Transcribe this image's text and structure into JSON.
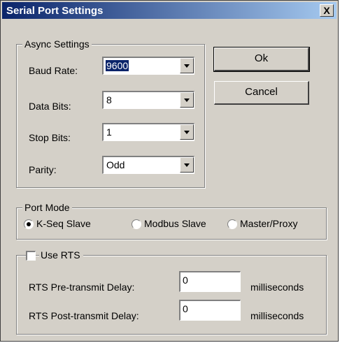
{
  "window": {
    "title": "Serial Port Settings",
    "close_label": "X"
  },
  "async": {
    "legend": "Async Settings",
    "baud_label": "Baud Rate:",
    "baud_value": "9600",
    "databits_label": "Data Bits:",
    "databits_value": "8",
    "stopbits_label": "Stop Bits:",
    "stopbits_value": "1",
    "parity_label": "Parity:",
    "parity_value": "Odd"
  },
  "buttons": {
    "ok": "Ok",
    "cancel": "Cancel"
  },
  "port_mode": {
    "legend": "Port Mode",
    "options": [
      "K-Seq Slave",
      "Modbus Slave",
      "Master/Proxy"
    ],
    "selected": "K-Seq Slave"
  },
  "rts": {
    "checkbox_label": "Use RTS",
    "checked": false,
    "pre_label": "RTS Pre-transmit Delay:",
    "pre_value": "0",
    "pre_unit": "milliseconds",
    "post_label": "RTS Post-transmit Delay:",
    "post_value": "0",
    "post_unit": "milliseconds"
  }
}
